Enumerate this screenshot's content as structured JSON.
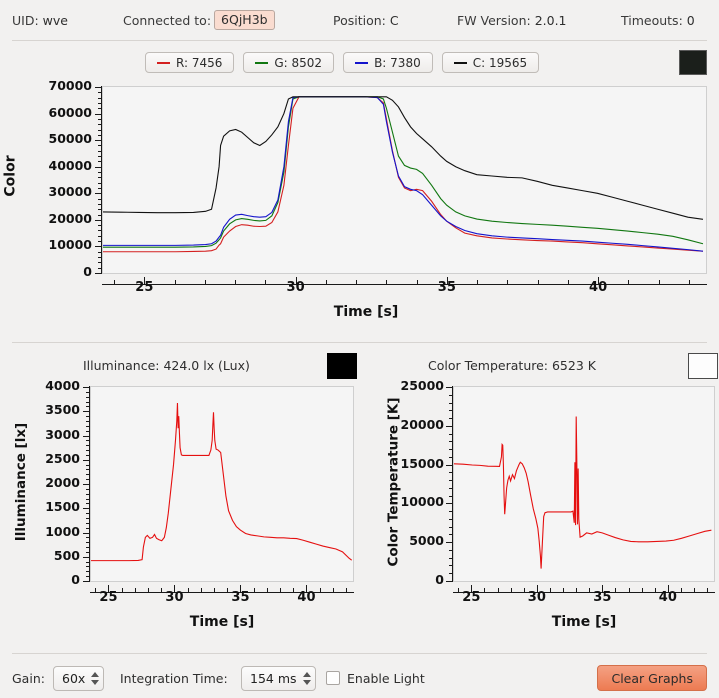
{
  "statusbar": {
    "uid_label": "UID:",
    "uid_value": "wve",
    "connected_label": "Connected to:",
    "connected_value": "6QjH3b",
    "position_label": "Position:",
    "position_value": "C",
    "fw_label": "FW Version:",
    "fw_value": "2.0.1",
    "timeouts_label": "Timeouts:",
    "timeouts_value": "0"
  },
  "legend": [
    {
      "label": "R: 7456",
      "color": "#d42020"
    },
    {
      "label": "G: 8502",
      "color": "#117711"
    },
    {
      "label": "B: 7380",
      "color": "#1414cc"
    },
    {
      "label": "C: 19565",
      "color": "#111111"
    }
  ],
  "swatches": {
    "color_swatch": "#1b1f1b",
    "illuminance_swatch": "#000000",
    "color_temperature_swatch": "#fdfdfd"
  },
  "subheaders": {
    "illuminance": "Illuminance: 424.0 lx (Lux)",
    "color_temperature": "Color Temperature: 6523 K"
  },
  "toolbar": {
    "gain_label": "Gain:",
    "gain_value": "60x",
    "integration_label": "Integration Time:",
    "integration_value": "154 ms",
    "enable_light_label": "Enable Light",
    "enable_light_checked": false,
    "clear_label": "Clear Graphs",
    "clear_color": "#ef8158"
  },
  "chart_data": [
    {
      "id": "color",
      "type": "line",
      "title": "",
      "xlabel": "Time [s]",
      "ylabel": "Color",
      "xlim": [
        23.6,
        43.6
      ],
      "ylim": [
        0,
        70000
      ],
      "xticks": [
        25,
        30,
        35,
        40
      ],
      "yticks": [
        0,
        10000,
        20000,
        30000,
        40000,
        50000,
        60000,
        70000
      ],
      "grid": false,
      "legend_position": "top",
      "x": [
        23.6,
        24.2,
        24.8,
        25.4,
        26.0,
        26.6,
        27.0,
        27.2,
        27.35,
        27.45,
        27.5,
        27.6,
        27.8,
        28.0,
        28.2,
        28.4,
        28.6,
        28.8,
        29.0,
        29.2,
        29.4,
        29.6,
        29.75,
        29.9,
        30.1,
        30.4,
        30.8,
        31.5,
        32.3,
        32.7,
        32.9,
        33.0,
        33.2,
        33.4,
        33.6,
        33.8,
        34.0,
        34.2,
        34.5,
        34.8,
        35.0,
        35.3,
        35.6,
        36.0,
        36.5,
        37.0,
        37.5,
        38.0,
        38.5,
        39.0,
        39.5,
        40.0,
        40.5,
        41.0,
        41.5,
        42.0,
        42.5,
        43.0,
        43.5
      ],
      "series": [
        {
          "name": "R",
          "color": "#d42020",
          "values": [
            8000,
            8000,
            8000,
            8000,
            8000,
            8100,
            8200,
            8400,
            9000,
            10500,
            11000,
            13500,
            15800,
            17500,
            18200,
            18000,
            17600,
            17500,
            17600,
            19000,
            23000,
            33000,
            48000,
            62000,
            66300,
            66300,
            66300,
            66300,
            66300,
            66000,
            64000,
            58000,
            46000,
            36000,
            32000,
            31000,
            31500,
            31000,
            27000,
            22000,
            19500,
            17000,
            15000,
            14000,
            13200,
            12800,
            12500,
            12200,
            12000,
            11700,
            11400,
            11000,
            10600,
            10200,
            9800,
            9400,
            9000,
            8600,
            8200
          ]
        },
        {
          "name": "G",
          "color": "#117711",
          "values": [
            9700,
            9700,
            9700,
            9700,
            9700,
            9800,
            10000,
            10300,
            11200,
            12500,
            13200,
            15800,
            18500,
            20000,
            20500,
            20200,
            19800,
            19600,
            19800,
            21500,
            26500,
            38000,
            55000,
            65500,
            66300,
            66300,
            66300,
            66300,
            66300,
            66300,
            65500,
            62000,
            53000,
            44000,
            40500,
            39500,
            39000,
            37500,
            33000,
            28000,
            25500,
            23000,
            21500,
            20300,
            19500,
            19000,
            18600,
            18300,
            18000,
            17600,
            17200,
            16800,
            16300,
            15800,
            15200,
            14600,
            13800,
            12500,
            11000
          ]
        },
        {
          "name": "B",
          "color": "#1414cc",
          "values": [
            10400,
            10400,
            10400,
            10400,
            10400,
            10500,
            10700,
            11000,
            12000,
            13500,
            14200,
            17200,
            20200,
            21800,
            22100,
            21600,
            21200,
            21000,
            21200,
            22800,
            27500,
            40000,
            57000,
            66000,
            66300,
            66300,
            66300,
            66300,
            66300,
            66000,
            63500,
            57000,
            45500,
            36500,
            32500,
            31500,
            31000,
            29500,
            25500,
            21500,
            19500,
            17500,
            16000,
            14800,
            14000,
            13500,
            13200,
            12900,
            12600,
            12300,
            12000,
            11600,
            11200,
            10800,
            10300,
            9800,
            9300,
            8800,
            8200
          ]
        },
        {
          "name": "C",
          "color": "#111111",
          "values": [
            23000,
            22900,
            22800,
            22700,
            22700,
            22800,
            23200,
            24000,
            32000,
            40000,
            48000,
            51500,
            53500,
            54000,
            53000,
            51000,
            49000,
            48000,
            49500,
            52000,
            55000,
            60000,
            65500,
            66300,
            66300,
            66300,
            66300,
            66300,
            66300,
            66300,
            66300,
            66300,
            65000,
            62500,
            58500,
            55000,
            52500,
            50500,
            47500,
            44000,
            42000,
            40000,
            38500,
            37000,
            36500,
            36000,
            35800,
            34500,
            33000,
            32000,
            31000,
            30000,
            28500,
            27000,
            25500,
            24000,
            22500,
            21000,
            20200
          ]
        }
      ]
    },
    {
      "id": "illuminance",
      "type": "line",
      "title": "",
      "xlabel": "Time [s]",
      "ylabel": "Illuminance [lx]",
      "xlim": [
        23.6,
        43.6
      ],
      "ylim": [
        0,
        4000
      ],
      "xticks": [
        25,
        30,
        35,
        40
      ],
      "yticks": [
        0,
        500,
        1000,
        1500,
        2000,
        2500,
        3000,
        3500,
        4000
      ],
      "grid": false,
      "color": "#e51010",
      "x": [
        23.6,
        24.5,
        25.5,
        26.5,
        27.2,
        27.5,
        27.6,
        27.75,
        27.9,
        28.1,
        28.3,
        28.45,
        28.6,
        28.8,
        29.0,
        29.2,
        29.35,
        29.5,
        29.7,
        29.9,
        30.05,
        30.15,
        30.2,
        30.25,
        30.3,
        30.35,
        30.4,
        30.5,
        30.6,
        30.8,
        31.2,
        32.0,
        32.6,
        32.75,
        32.85,
        32.9,
        32.95,
        33.0,
        33.05,
        33.15,
        33.3,
        33.5,
        33.7,
        33.9,
        34.1,
        34.4,
        34.7,
        35.0,
        35.4,
        35.8,
        36.3,
        36.8,
        37.3,
        37.8,
        38.3,
        38.8,
        39.3,
        39.8,
        40.3,
        40.8,
        41.3,
        41.8,
        42.3,
        42.8,
        43.3,
        43.5
      ],
      "y": [
        420,
        420,
        420,
        420,
        425,
        440,
        700,
        900,
        940,
        880,
        900,
        960,
        880,
        850,
        830,
        900,
        1100,
        1400,
        1900,
        2400,
        2900,
        3300,
        3670,
        3150,
        3400,
        3050,
        2750,
        2600,
        2590,
        2590,
        2590,
        2590,
        2590,
        2700,
        2900,
        3200,
        3480,
        3150,
        2900,
        2720,
        2700,
        2650,
        2200,
        1750,
        1450,
        1250,
        1120,
        1050,
        980,
        950,
        930,
        910,
        900,
        890,
        890,
        880,
        875,
        840,
        800,
        760,
        720,
        690,
        660,
        600,
        470,
        430
      ]
    },
    {
      "id": "color_temperature",
      "type": "line",
      "title": "",
      "xlabel": "Time [s]",
      "ylabel": "Color Temperature [K]",
      "xlim": [
        23.6,
        43.6
      ],
      "ylim": [
        0,
        25000
      ],
      "xticks": [
        25,
        30,
        35,
        40
      ],
      "yticks": [
        0,
        5000,
        10000,
        15000,
        20000,
        25000
      ],
      "grid": false,
      "color": "#e51010",
      "x": [
        23.6,
        24.3,
        25.0,
        25.6,
        26.2,
        26.8,
        27.1,
        27.25,
        27.3,
        27.35,
        27.4,
        27.45,
        27.5,
        27.55,
        27.65,
        27.75,
        27.85,
        27.95,
        28.1,
        28.25,
        28.4,
        28.5,
        28.6,
        28.7,
        28.85,
        29.0,
        29.15,
        29.3,
        29.5,
        29.7,
        29.9,
        30.05,
        30.15,
        30.25,
        30.3,
        30.4,
        30.5,
        30.6,
        30.8,
        31.2,
        31.8,
        32.4,
        32.6,
        32.75,
        32.85,
        32.9,
        32.95,
        33.0,
        33.05,
        33.1,
        33.15,
        33.2,
        33.3,
        33.5,
        33.8,
        34.2,
        34.6,
        35.0,
        35.5,
        36.0,
        36.6,
        37.2,
        37.8,
        38.5,
        39.2,
        39.9,
        40.5,
        41.1,
        41.7,
        42.3,
        42.9,
        43.4
      ],
      "y": [
        15100,
        15050,
        14950,
        14900,
        14800,
        14780,
        14760,
        16000,
        17600,
        17500,
        15000,
        11000,
        8600,
        9700,
        12000,
        13000,
        13500,
        12900,
        13700,
        13200,
        14200,
        14600,
        15000,
        15300,
        15100,
        14600,
        13900,
        12800,
        11000,
        9300,
        8000,
        6800,
        5200,
        3200,
        1600,
        5000,
        8300,
        8800,
        8900,
        8900,
        8900,
        8900,
        8900,
        9000,
        7500,
        15300,
        7200,
        21200,
        15200,
        7300,
        14500,
        8000,
        5650,
        5800,
        6200,
        6050,
        6350,
        6200,
        5900,
        5600,
        5300,
        5100,
        5050,
        5050,
        5100,
        5150,
        5250,
        5500,
        5800,
        6100,
        6400,
        6550
      ]
    }
  ]
}
